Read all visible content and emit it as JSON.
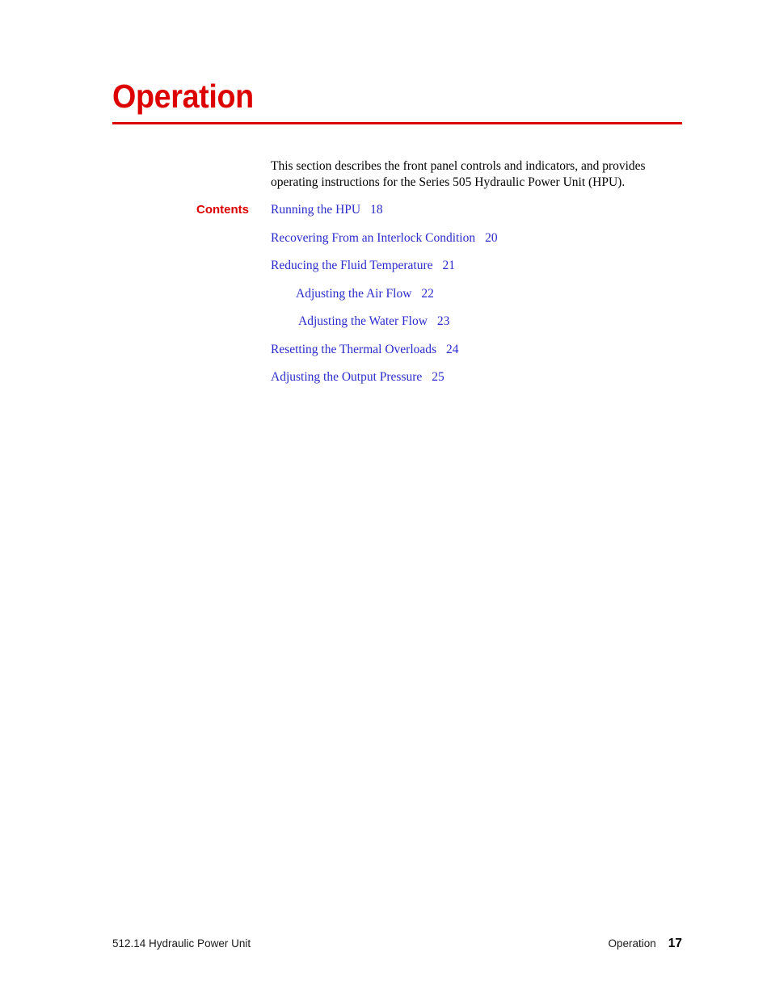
{
  "document": {
    "chapter_title": "Operation",
    "intro_paragraph": "This section describes the front panel controls and indicators, and provides operating instructions for the Series 505 Hydraulic Power Unit (HPU)."
  },
  "contents": {
    "label": "Contents",
    "entries": [
      {
        "title": "Running the HPU",
        "page": "18",
        "level": 1
      },
      {
        "title": "Recovering From an Interlock Condition",
        "page": "20",
        "level": 1
      },
      {
        "title": "Reducing the Fluid Temperature",
        "page": "21",
        "level": 1
      },
      {
        "title": "Adjusting the Air Flow",
        "page": "22",
        "level": 2
      },
      {
        "title": "Adjusting the Water Flow",
        "page": "23",
        "level": 2
      },
      {
        "title": "Resetting the Thermal Overloads",
        "page": "24",
        "level": 1
      },
      {
        "title": "Adjusting the Output Pressure",
        "page": "25",
        "level": 1
      }
    ]
  },
  "footer": {
    "manual": "512.14 Hydraulic Power Unit",
    "section": "Operation",
    "page_number": "17"
  },
  "colors": {
    "accent_red": "#DD0000",
    "link_blue": "#2B2BCC",
    "body_text": "#000000",
    "page_background": "#ffffff"
  }
}
